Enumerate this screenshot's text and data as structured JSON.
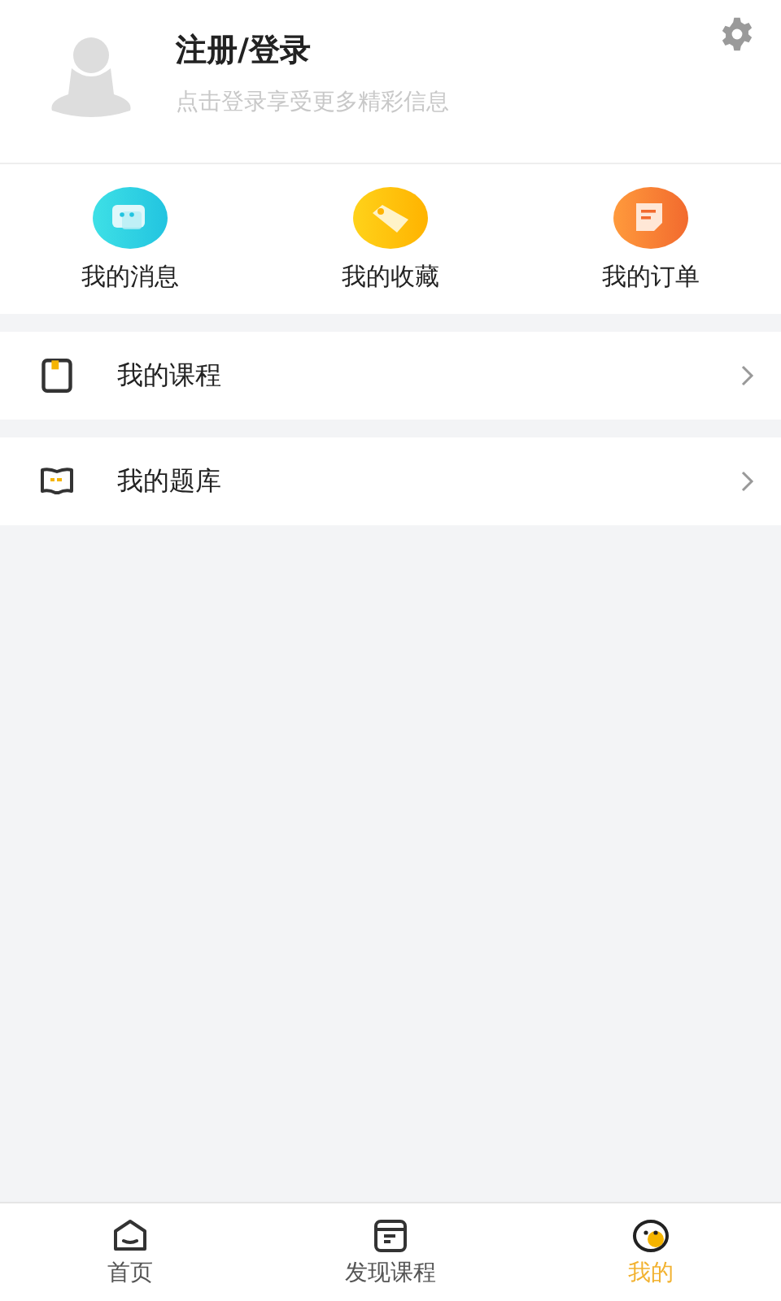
{
  "profile": {
    "title": "注册/登录",
    "subtitle": "点击登录享受更多精彩信息"
  },
  "shortcuts": [
    {
      "kind": "message",
      "label": "我的消息"
    },
    {
      "kind": "favorite",
      "label": "我的收藏"
    },
    {
      "kind": "order",
      "label": "我的订单"
    }
  ],
  "menu": [
    {
      "kind": "course",
      "label": "我的课程"
    },
    {
      "kind": "questions",
      "label": "我的题库"
    }
  ],
  "tabs": [
    {
      "kind": "home",
      "label": "首页",
      "selected": false
    },
    {
      "kind": "discover",
      "label": "发现课程",
      "selected": false
    },
    {
      "kind": "me",
      "label": "我的",
      "selected": true
    }
  ]
}
